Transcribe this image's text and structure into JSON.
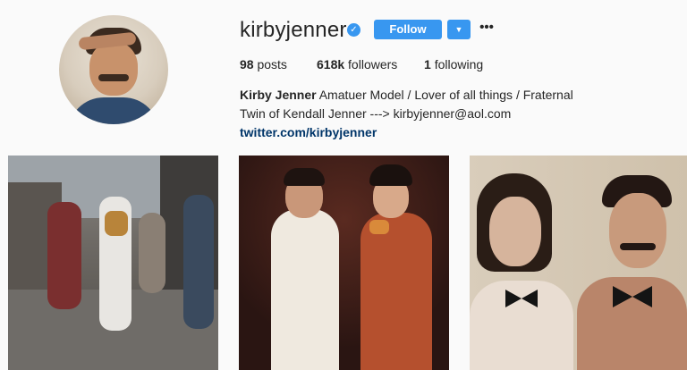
{
  "profile": {
    "username": "kirbyjenner",
    "verified_icon": "verified-badge-icon",
    "follow_label": "Follow",
    "dropdown_icon": "chevron-down-icon",
    "more_icon": "more-options-icon",
    "more_label": "•••",
    "dropdown_label": "▼",
    "verified_label": "✓"
  },
  "stats": {
    "posts_count": "98",
    "posts_label": "posts",
    "followers_count": "618k",
    "followers_label": "followers",
    "following_count": "1",
    "following_label": "following"
  },
  "bio": {
    "name": "Kirby Jenner",
    "text": "Amatuer Model / Lover of all things / Fraternal Twin of Kendall Jenner ---> kirbyjenner@aol.com",
    "link": "twitter.com/kirbyjenner"
  },
  "colors": {
    "accent": "#3897f0",
    "link": "#003569",
    "background": "#fafafa"
  },
  "posts": [
    {
      "alt": "street-photo"
    },
    {
      "alt": "pizza-photo"
    },
    {
      "alt": "portrait-photo"
    }
  ]
}
